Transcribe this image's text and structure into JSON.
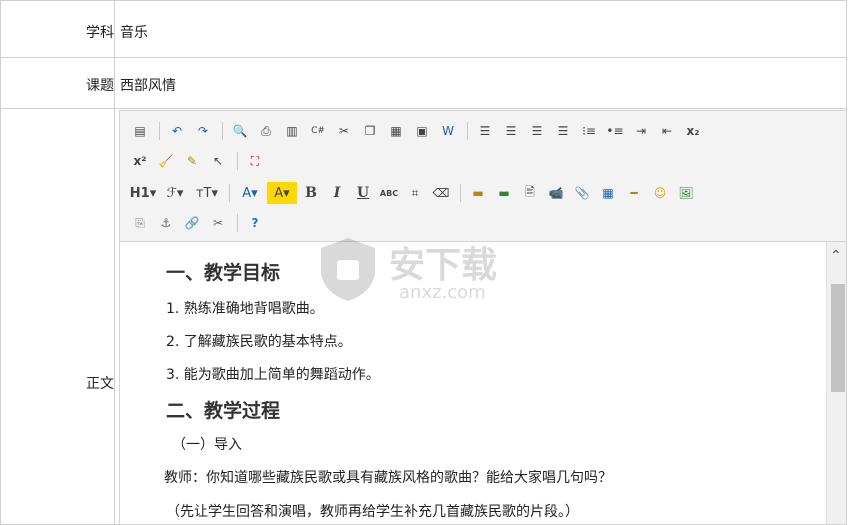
{
  "subject": {
    "label": "学科",
    "value": "音乐"
  },
  "topic": {
    "label": "课题",
    "value": "西部风情"
  },
  "body": {
    "label": "正文"
  },
  "toolbar": {
    "row1": [
      "paste-icon",
      "undo-icon",
      "redo-icon",
      "preview-icon",
      "print-icon",
      "template-icon",
      "code-icon",
      "cut-icon",
      "copy-icon",
      "paste-text-icon",
      "paste-plain-icon",
      "paste-word-icon",
      "align-left-icon",
      "align-center-icon",
      "align-right-icon",
      "justify-icon",
      "ordered-list-icon",
      "unordered-list-icon",
      "indent-icon",
      "outdent-icon"
    ],
    "subscript": "x₂",
    "superscript": "x²",
    "heading": "H1▾",
    "font": "ℱ▾",
    "fontsize": "тT▾",
    "fontcolor": "A▾",
    "bgcolor": "A▾",
    "bold": "B",
    "italic": "I",
    "underline": "U",
    "strike": "ABC",
    "accent": "#ffd800",
    "brand": "#1a7ac8"
  },
  "content": {
    "h1": "一、教学目标",
    "items": [
      "1. 熟练准确地背唱歌曲。",
      "2. 了解藏族民歌的基本特点。",
      "3. 能为歌曲加上简单的舞蹈动作。"
    ],
    "h2": "二、教学过程",
    "sub1": "（一）导入",
    "teacher": "教师：你知道哪些藏族民歌或具有藏族风格的歌曲？能给大家唱几句吗？",
    "note": "（先让学生回答和演唱，教师再给学生补充几首藏族民歌的片段。）"
  },
  "watermark": {
    "text": "安下载",
    "sub": "anxz.com"
  }
}
